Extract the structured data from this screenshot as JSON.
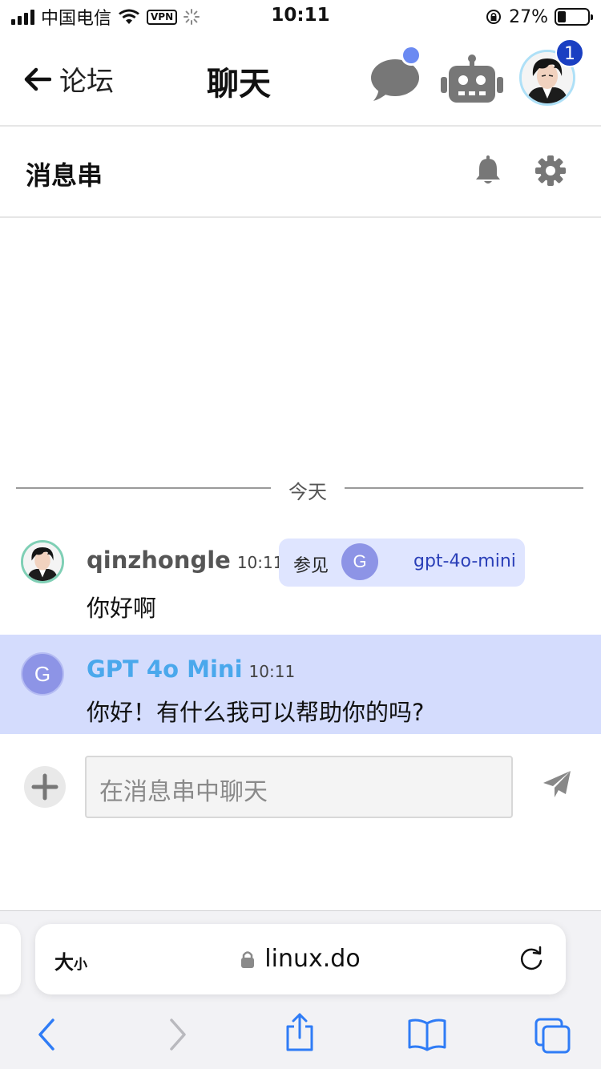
{
  "status": {
    "carrier": "中国电信",
    "vpn": "VPN",
    "time": "10:11",
    "battery": "27%",
    "battery_level": 0.27
  },
  "header": {
    "back_label": "论坛",
    "title": "聊天",
    "notification_count": "1",
    "icons": [
      "arrow-left-icon",
      "chat-bubble-icon",
      "robot-icon",
      "avatar"
    ]
  },
  "thread": {
    "title": "消息串",
    "icons": [
      "bell-icon",
      "gear-icon"
    ]
  },
  "day_divider": "今天",
  "messages": [
    {
      "author": "qinzhongle",
      "time": "10:11",
      "text": "你好啊",
      "see_also": {
        "label": "参见",
        "avatar_letter": "G",
        "link": "gpt-4o-mini"
      }
    },
    {
      "author": "GPT 4o Mini",
      "time": "10:11",
      "avatar_letter": "G",
      "text": "你好！有什么我可以帮助你的吗?",
      "highlight_color": "#d4dcfd",
      "author_color": "#4aa8ec"
    }
  ],
  "composer": {
    "placeholder": "在消息串中聊天"
  },
  "browser": {
    "text_size": "大",
    "text_size_small": "小",
    "url": "linux.do",
    "toolbar_icons": [
      "back-icon",
      "forward-icon",
      "share-icon",
      "bookmarks-icon",
      "tabs-icon"
    ],
    "accent": "#2f7cf6"
  }
}
